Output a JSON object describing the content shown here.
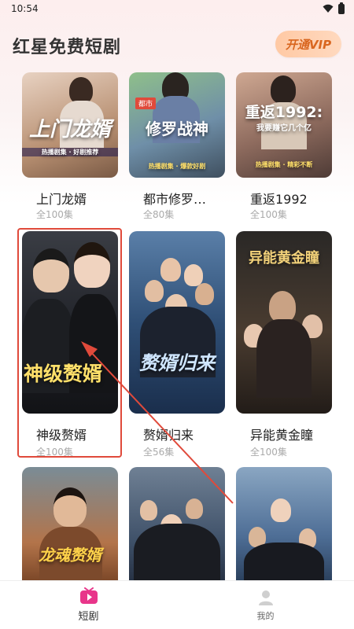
{
  "status": {
    "time": "10:54"
  },
  "header": {
    "title": "红星免费短剧",
    "vip_label": "开通VIP"
  },
  "dramas": [
    {
      "title": "上门龙婿",
      "episodes": "全100集",
      "poster_text": "上门龙婿",
      "poster_sub": "热播剧集 · 好剧推荐"
    },
    {
      "title": "都市修罗…",
      "episodes": "全80集",
      "poster_text": "修罗战神",
      "poster_tag": "都市",
      "poster_sub": "热播剧集 · 爆款好剧"
    },
    {
      "title": "重返1992",
      "episodes": "全100集",
      "poster_text": "重返1992:",
      "poster_sub2": "我要赚它几个亿",
      "poster_sub": "热播剧集 · 精彩不断"
    },
    {
      "title": "神级赘婿",
      "episodes": "全100集",
      "poster_text": "神级赘婿"
    },
    {
      "title": "赘婿归来",
      "episodes": "全56集",
      "poster_text": "赘婿归来"
    },
    {
      "title": "异能黄金瞳",
      "episodes": "全100集",
      "poster_text": "异能黄金瞳"
    },
    {
      "title": "",
      "episodes": "",
      "poster_text": "龙魂赘婿"
    },
    {
      "title": "",
      "episodes": "",
      "poster_text": ""
    },
    {
      "title": "",
      "episodes": "",
      "poster_text": ""
    }
  ],
  "nav": {
    "tab_drama": "短剧",
    "tab_mine": "我的"
  },
  "colors": {
    "accent": "#e04a3b",
    "vip_text": "#d9661f",
    "nav_active": "#e8358a"
  }
}
